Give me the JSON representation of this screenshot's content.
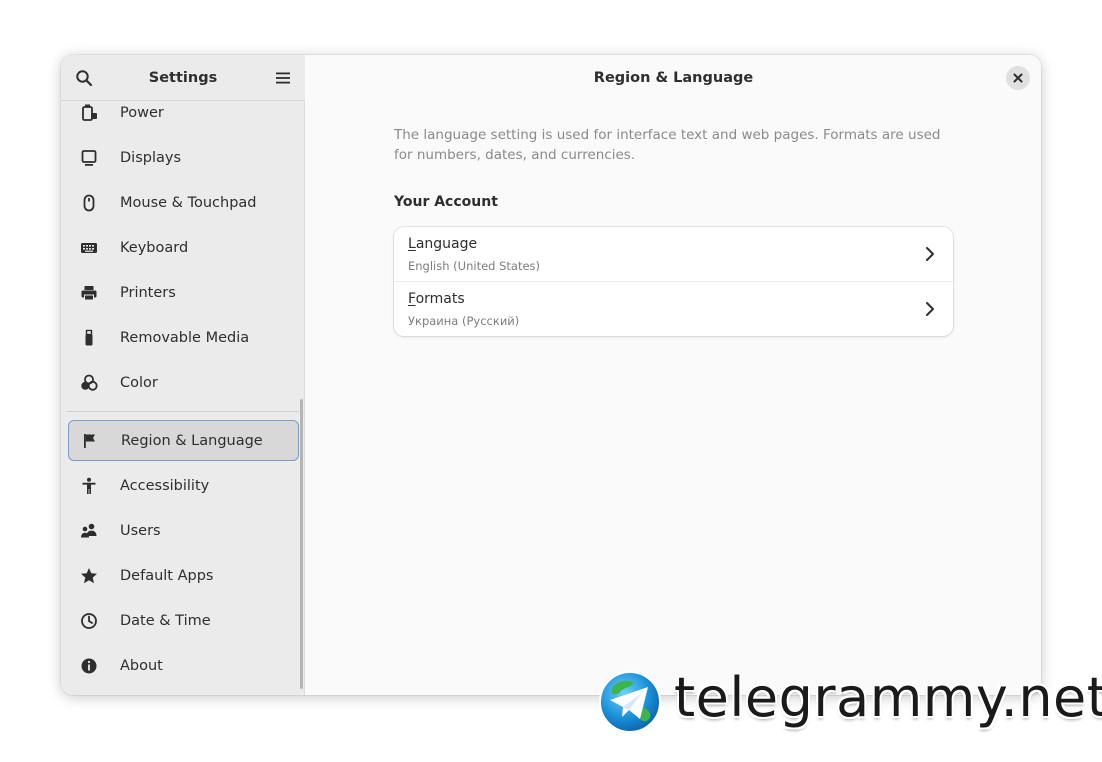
{
  "window": {
    "sidebar_title": "Settings",
    "content_title": "Region & Language"
  },
  "sidebar": {
    "items": [
      {
        "label": "Power",
        "icon": "power-icon"
      },
      {
        "label": "Displays",
        "icon": "display-icon"
      },
      {
        "label": "Mouse & Touchpad",
        "icon": "mouse-icon"
      },
      {
        "label": "Keyboard",
        "icon": "keyboard-icon"
      },
      {
        "label": "Printers",
        "icon": "printer-icon"
      },
      {
        "label": "Removable Media",
        "icon": "usb-icon"
      },
      {
        "label": "Color",
        "icon": "color-icon"
      },
      {
        "label": "Region & Language",
        "icon": "flag-icon",
        "selected": true
      },
      {
        "label": "Accessibility",
        "icon": "accessibility-icon"
      },
      {
        "label": "Users",
        "icon": "users-icon"
      },
      {
        "label": "Default Apps",
        "icon": "star-icon"
      },
      {
        "label": "Date & Time",
        "icon": "clock-icon"
      },
      {
        "label": "About",
        "icon": "info-icon"
      }
    ]
  },
  "content": {
    "description": "The language setting is used for interface text and web pages. Formats are used for numbers, dates, and currencies.",
    "section_title": "Your Account",
    "rows": [
      {
        "mnemonic": "L",
        "rest": "anguage",
        "subtitle": "English (United States)"
      },
      {
        "mnemonic": "F",
        "rest": "ormats",
        "subtitle": "Украина (Русский)"
      }
    ]
  },
  "watermark": {
    "text": "telegrammy.net"
  },
  "colors": {
    "selection_border": "#7a9ccf",
    "sidebar_bg": "#ebebeb",
    "content_bg": "#fafafa"
  }
}
